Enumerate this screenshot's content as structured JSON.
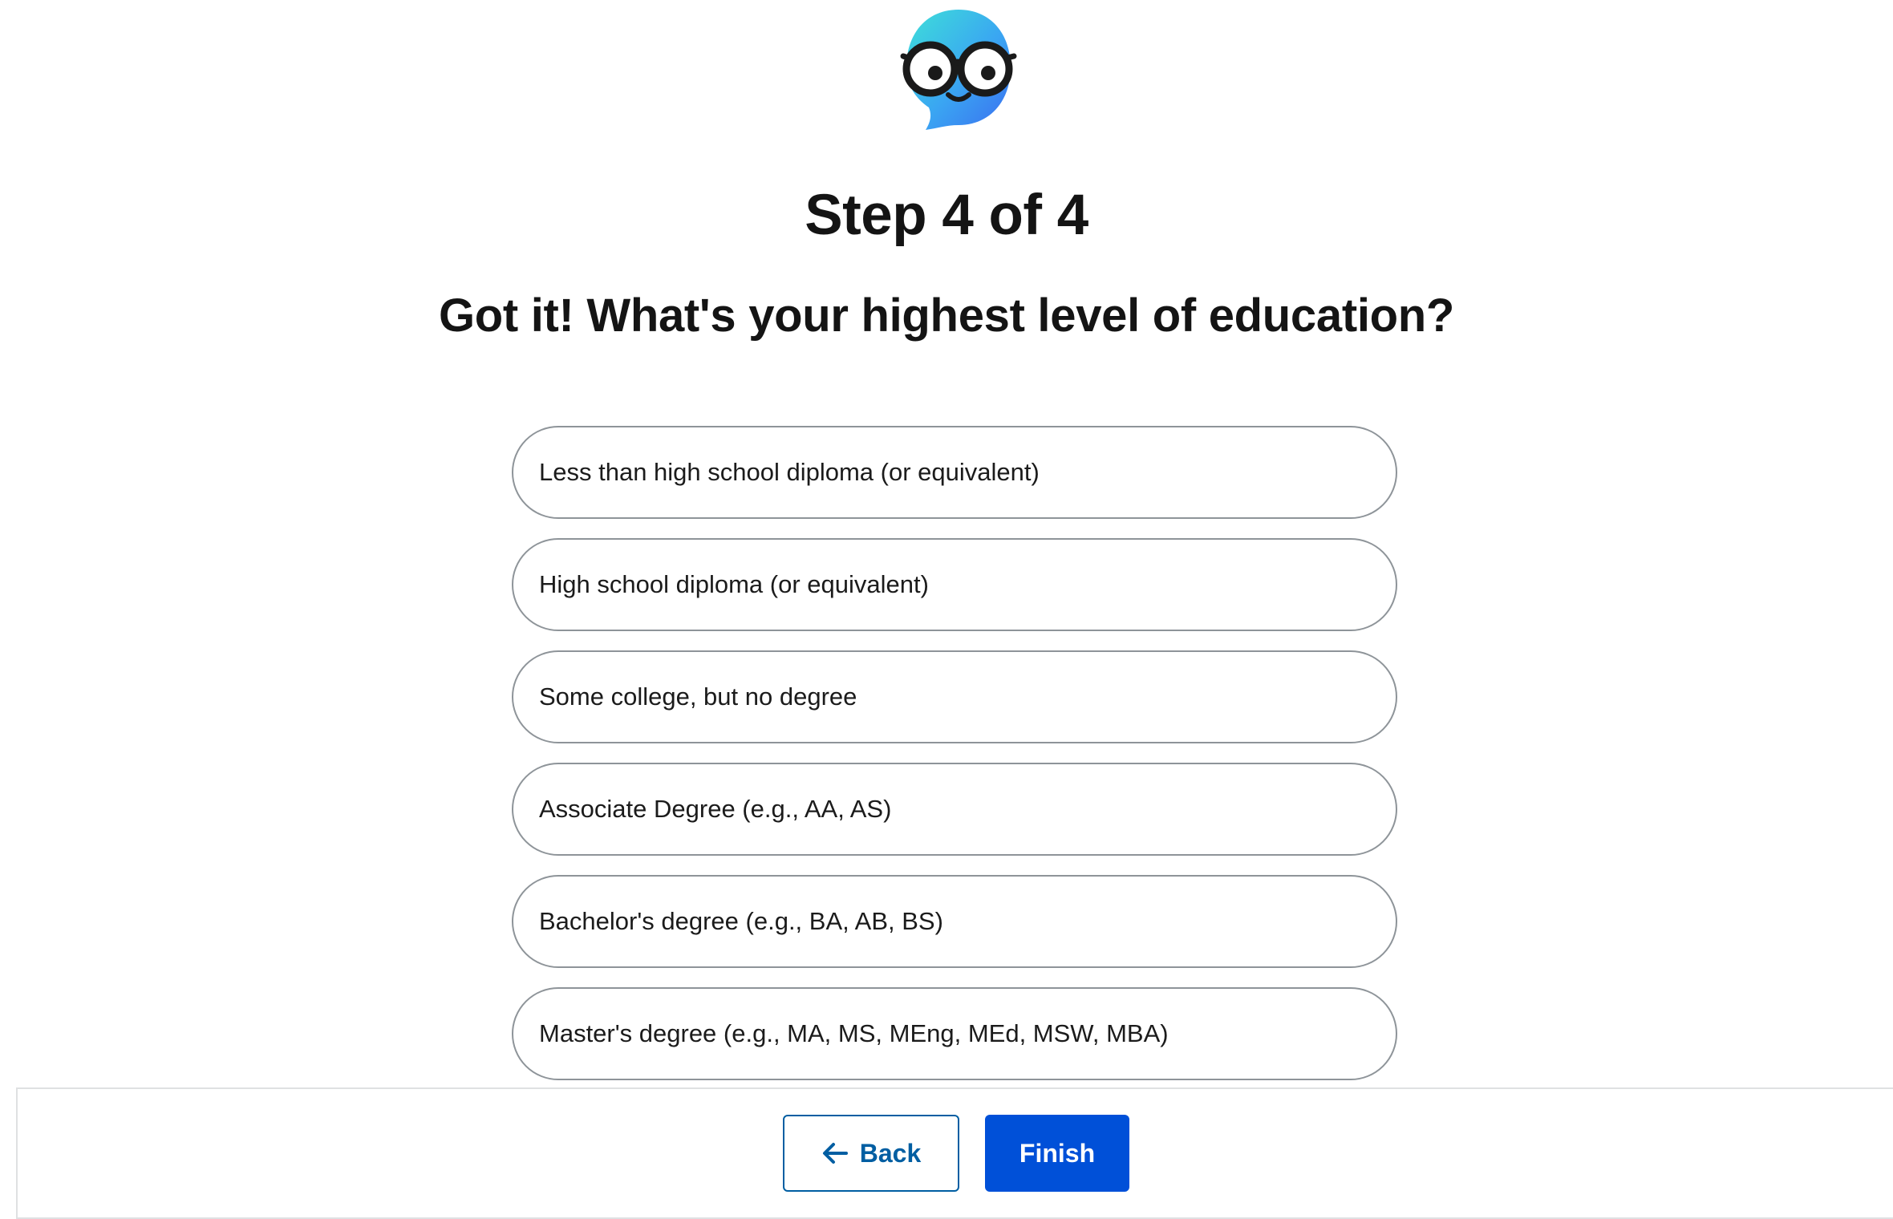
{
  "avatar": {
    "icon": "nerd-face-avatar-icon"
  },
  "header": {
    "step_title": "Step 4 of 4",
    "question": "Got it! What's your highest level of education?"
  },
  "options": [
    {
      "label": "Less than high school diploma (or equivalent)"
    },
    {
      "label": "High school diploma (or equivalent)"
    },
    {
      "label": "Some college, but no degree"
    },
    {
      "label": "Associate Degree (e.g., AA, AS)"
    },
    {
      "label": "Bachelor's degree (e.g., BA, AB, BS)"
    },
    {
      "label": "Master's degree (e.g., MA, MS, MEng, MEd, MSW, MBA)"
    }
  ],
  "footer": {
    "back_label": "Back",
    "back_icon": "arrow-left-icon",
    "finish_label": "Finish"
  },
  "colors": {
    "primary": "#0050d8",
    "outline_button": "#005ea2",
    "option_border": "#8e9499",
    "text": "#1b1b1b"
  }
}
